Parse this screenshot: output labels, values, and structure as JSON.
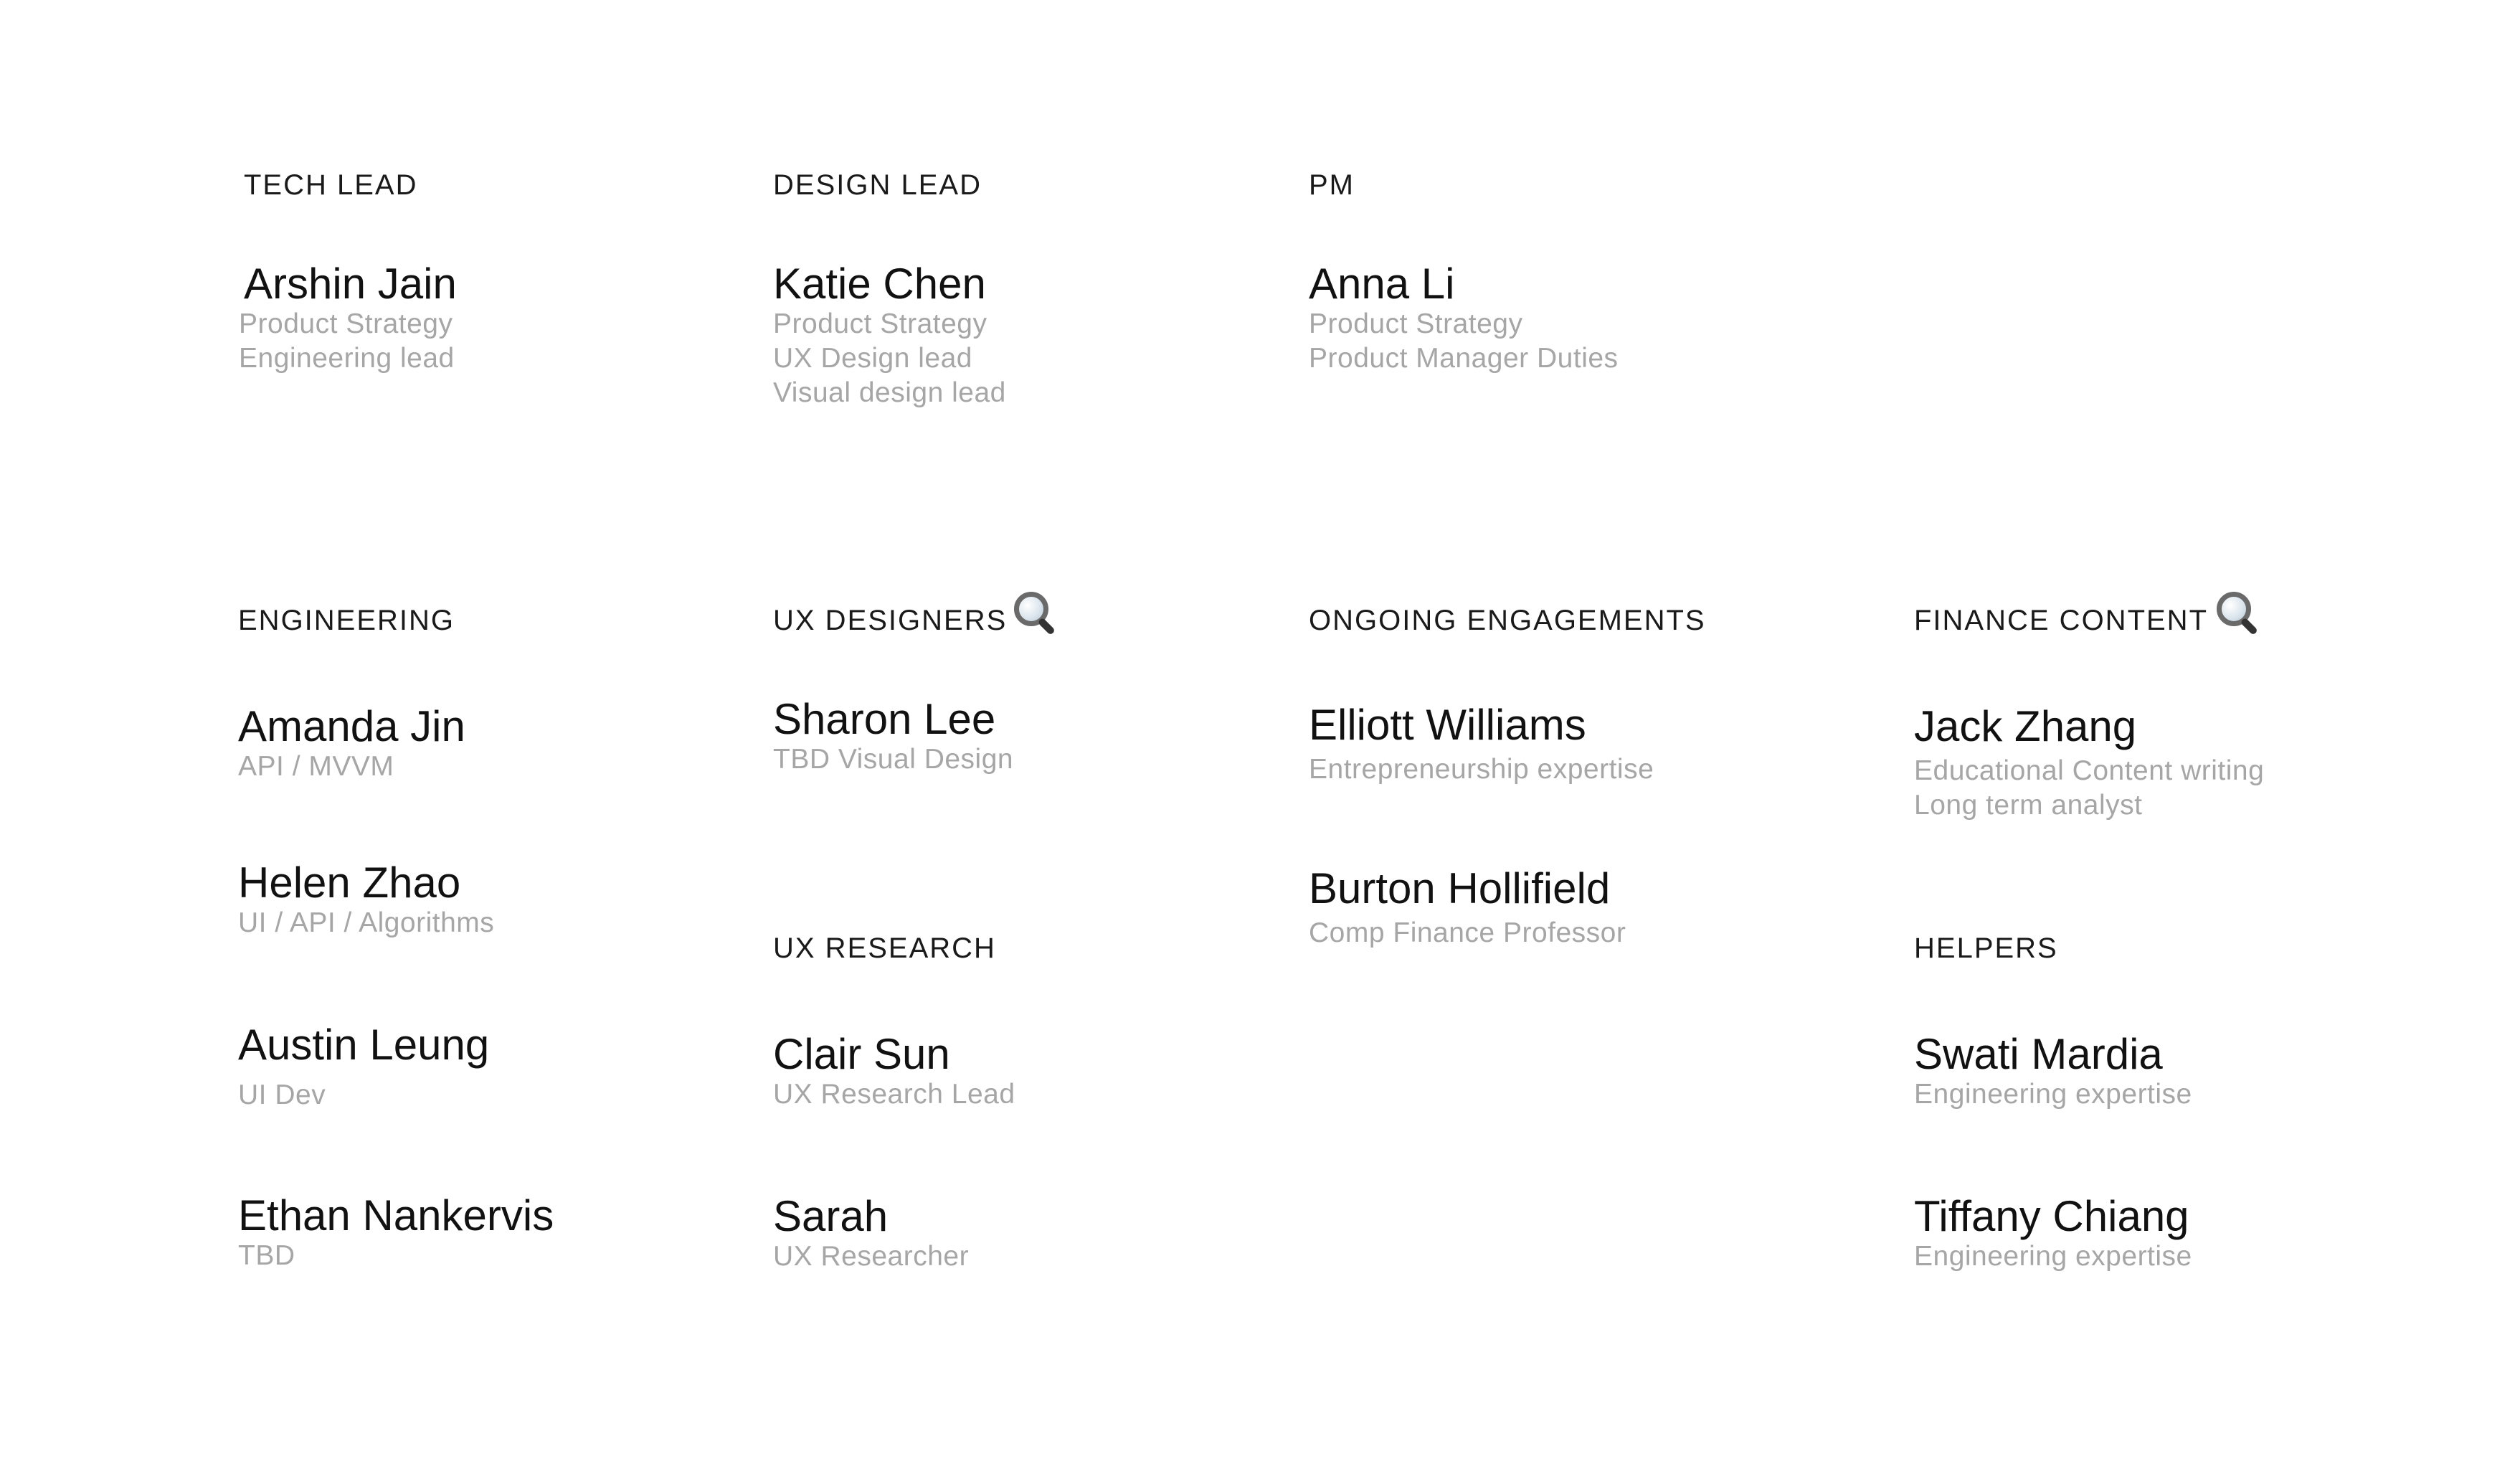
{
  "sections": {
    "tech_lead": {
      "heading": "TECH LEAD",
      "people": [
        {
          "name": "Arshin Jain",
          "roles": [
            "Product Strategy",
            "Engineering lead"
          ]
        }
      ]
    },
    "design_lead": {
      "heading": "DESIGN LEAD",
      "people": [
        {
          "name": "Katie Chen",
          "roles": [
            "Product Strategy",
            "UX Design lead",
            "Visual design lead"
          ]
        }
      ]
    },
    "pm": {
      "heading": "PM",
      "people": [
        {
          "name": "Anna Li",
          "roles": [
            "Product Strategy",
            "Product Manager Duties"
          ]
        }
      ]
    },
    "engineering": {
      "heading": "ENGINEERING",
      "people": [
        {
          "name": "Amanda Jin",
          "roles": [
            "API / MVVM"
          ]
        },
        {
          "name": "Helen Zhao",
          "roles": [
            "UI / API / Algorithms"
          ]
        },
        {
          "name": "Austin Leung",
          "roles": [
            "UI Dev"
          ]
        },
        {
          "name": "Ethan Nankervis",
          "roles": [
            "TBD"
          ]
        }
      ]
    },
    "ux_designers": {
      "heading": "UX DESIGNERS",
      "icon": "search-icon",
      "people": [
        {
          "name": "Sharon Lee",
          "roles": [
            "TBD Visual Design"
          ]
        }
      ]
    },
    "ux_research": {
      "heading": "UX RESEARCH",
      "people": [
        {
          "name": "Clair Sun",
          "roles": [
            "UX Research Lead"
          ]
        },
        {
          "name": "Sarah",
          "roles": [
            "UX Researcher"
          ]
        }
      ]
    },
    "ongoing_engagements": {
      "heading": "ONGOING ENGAGEMENTS",
      "people": [
        {
          "name": "Elliott Williams",
          "roles": [
            "Entrepreneurship expertise"
          ]
        },
        {
          "name": "Burton Hollifield",
          "roles": [
            "Comp Finance Professor"
          ]
        }
      ]
    },
    "finance_content": {
      "heading": "FINANCE CONTENT",
      "icon": "search-icon",
      "people": [
        {
          "name": "Jack Zhang",
          "roles": [
            "Educational Content writing",
            "Long term analyst"
          ]
        }
      ]
    },
    "helpers": {
      "heading": "HELPERS",
      "people": [
        {
          "name": "Swati Mardia",
          "roles": [
            "Engineering expertise"
          ]
        },
        {
          "name": "Tiffany Chiang",
          "roles": [
            "Engineering expertise"
          ]
        }
      ]
    }
  }
}
